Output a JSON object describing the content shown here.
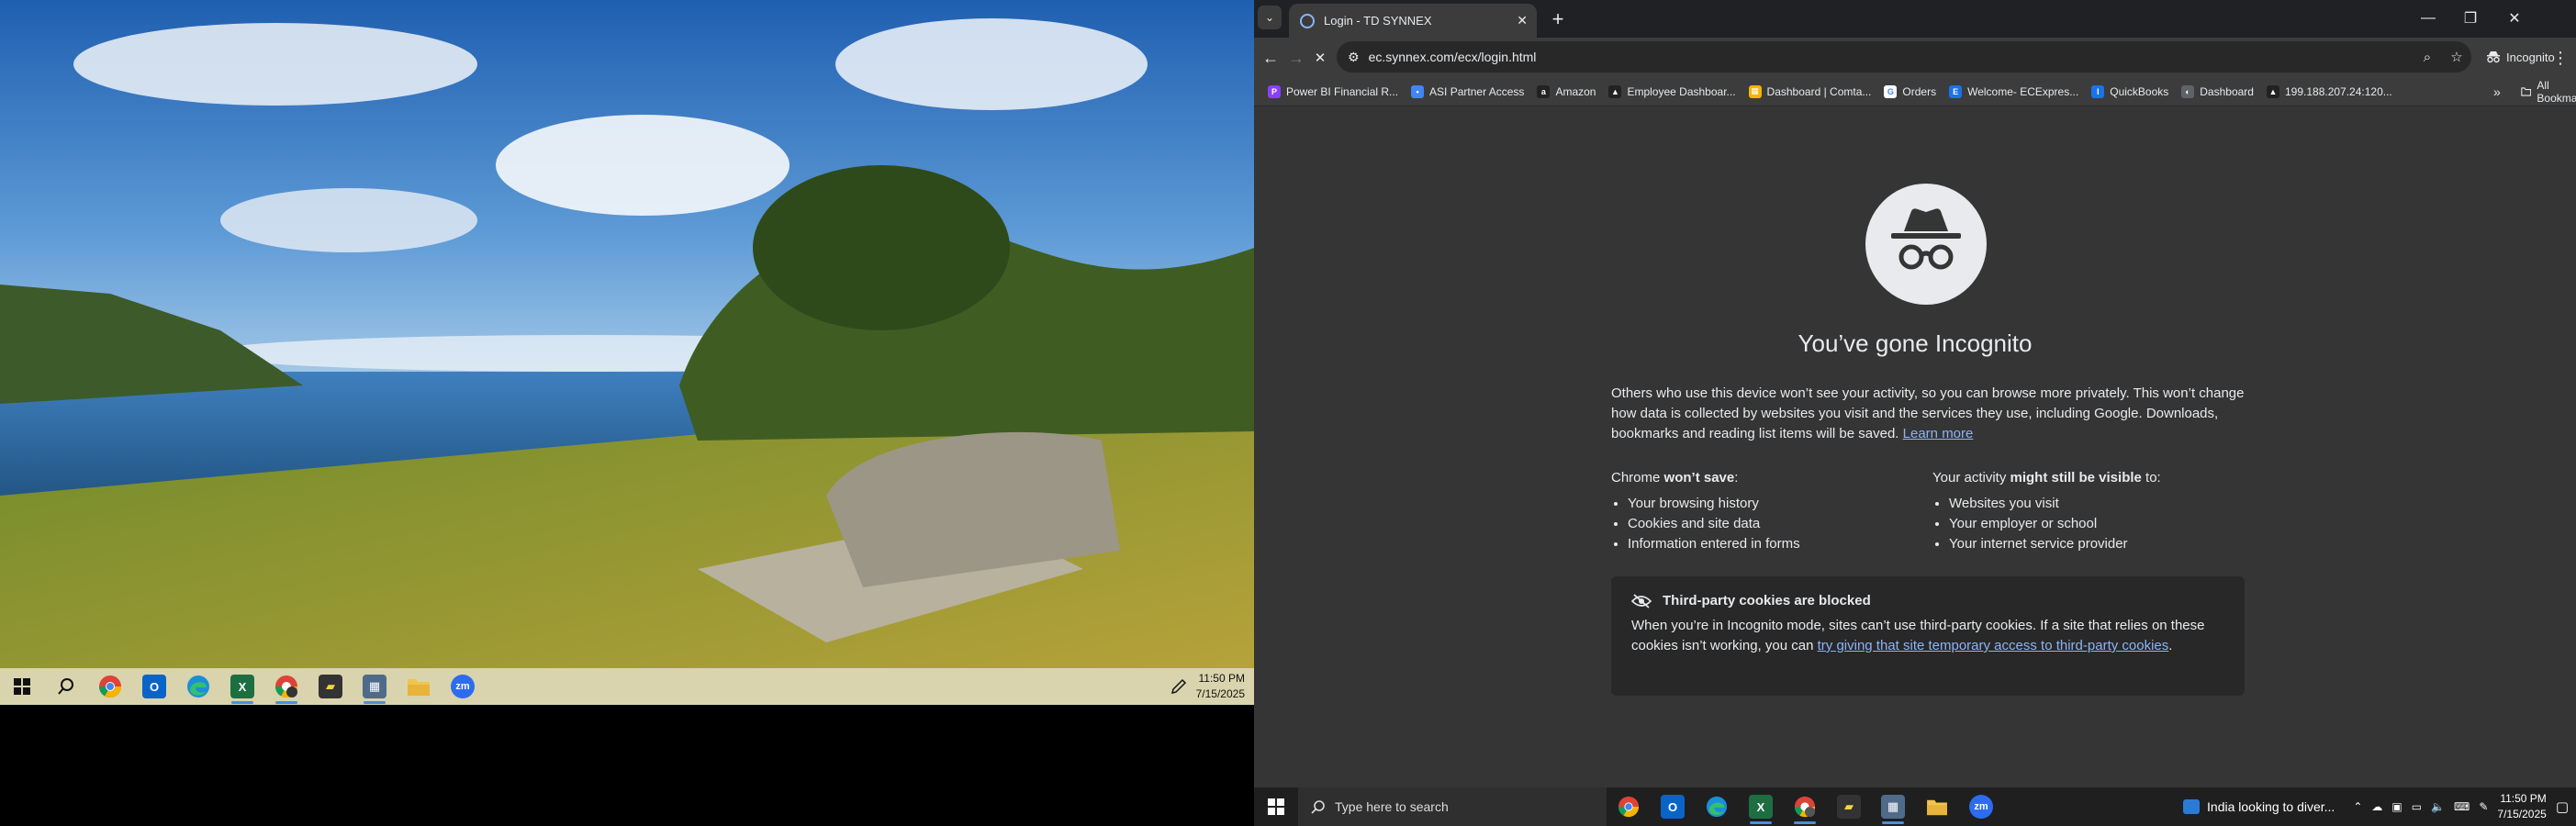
{
  "left_taskbar": {
    "clock_time": "11:50 PM",
    "clock_date": "7/15/2025"
  },
  "browser": {
    "tab_title": "Login - TD SYNNEX",
    "url": "ec.synnex.com/ecx/login.html",
    "incognito_label": "Incognito",
    "bookmarks": [
      {
        "label": "Power BI Financial R...",
        "color": "#8a3ffc",
        "icon": "P"
      },
      {
        "label": "ASI Partner Access",
        "color": "#4285f4",
        "icon": "•"
      },
      {
        "label": "Amazon",
        "color": "#222222",
        "icon": "a"
      },
      {
        "label": "Employee Dashboar...",
        "color": "#222222",
        "icon": "▲"
      },
      {
        "label": "Dashboard | Comta...",
        "color": "#f4b400",
        "icon": "▦"
      },
      {
        "label": "Orders",
        "color": "#ffffff",
        "icon": "G"
      },
      {
        "label": "Welcome- ECExpres...",
        "color": "#1a73e8",
        "icon": "E"
      },
      {
        "label": "QuickBooks",
        "color": "#1a73e8",
        "icon": "I"
      },
      {
        "label": "Dashboard",
        "color": "#5f6368",
        "icon": "◐"
      },
      {
        "label": "199.188.207.24:120...",
        "color": "#222222",
        "icon": "▲"
      }
    ],
    "all_bookmarks_label": "All Bookmarks"
  },
  "incognito_page": {
    "title": "You’ve gone Incognito",
    "intro": "Others who use this device won’t see your activity, so you can browse more privately. This won’t change how data is collected by websites you visit and the services they use, including Google. Downloads, bookmarks and reading list items will be saved.",
    "learn_more": "Learn more",
    "left_heading_prefix": "Chrome ",
    "left_heading_bold": "won’t save",
    "left_heading_suffix": ":",
    "left_items": [
      "Your browsing history",
      "Cookies and site data",
      "Information entered in forms"
    ],
    "right_heading_prefix": "Your activity ",
    "right_heading_bold": "might still be visible",
    "right_heading_suffix": " to:",
    "right_items": [
      "Websites you visit",
      "Your employer or school",
      "Your internet service provider"
    ],
    "cookie_title": "Third-party cookies are blocked",
    "cookie_text": "When you’re in Incognito mode, sites can’t use third-party cookies. If a site that relies on these cookies isn’t working, you can ",
    "cookie_link": "try giving that site temporary access to third-party cookies",
    "cookie_end": "."
  },
  "right_taskbar": {
    "search_placeholder": "Type here to search",
    "news": "India looking to diver...",
    "clock_time": "11:50 PM",
    "clock_date": "7/15/2025"
  },
  "colors": {
    "accent_link": "#8ab4f8",
    "page_bg": "#353535",
    "left_taskbar": "#d9d4ad"
  }
}
